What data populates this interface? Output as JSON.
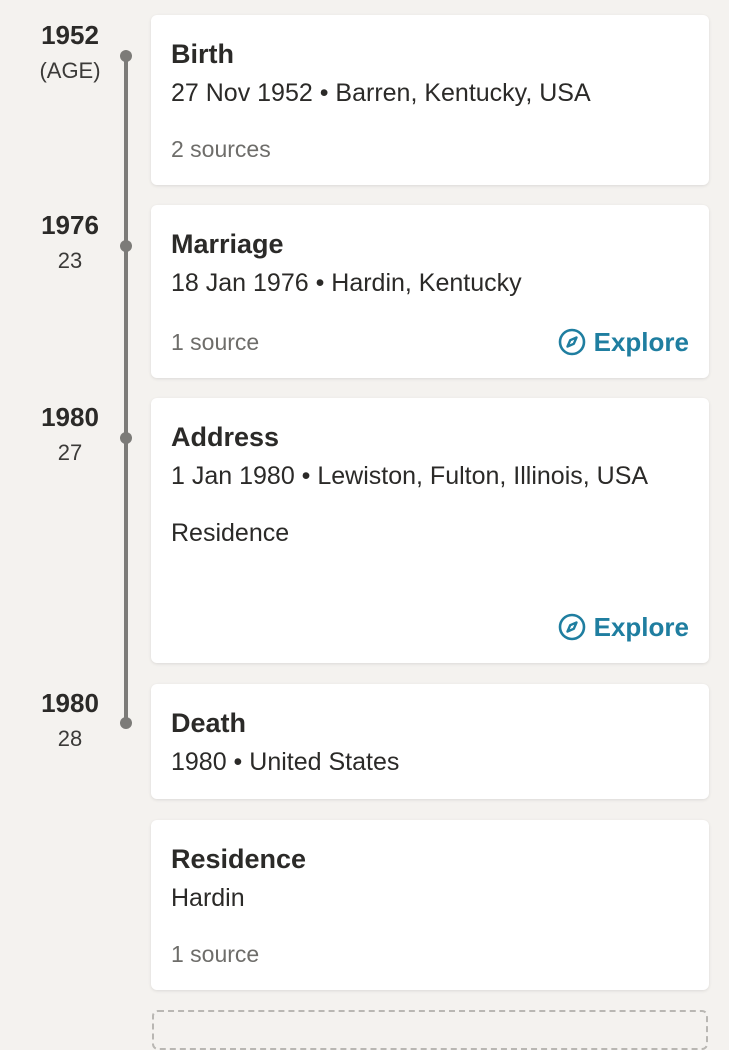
{
  "timeline": [
    {
      "year": "1952",
      "age": "(AGE)",
      "title": "Birth",
      "detail": "27 Nov 1952 • Barren, Kentucky, USA",
      "note": "",
      "sources": "2 sources",
      "explore": ""
    },
    {
      "year": "1976",
      "age": "23",
      "title": "Marriage",
      "detail": "18 Jan 1976 • Hardin, Kentucky",
      "note": "",
      "sources": "1 source",
      "explore": "Explore"
    },
    {
      "year": "1980",
      "age": "27",
      "title": "Address",
      "detail": "1 Jan 1980 • Lewiston, Fulton, Illinois, USA",
      "note": "Residence",
      "sources": "",
      "explore": "Explore"
    },
    {
      "year": "1980",
      "age": "28",
      "title": "Death",
      "detail": "1980 • United States",
      "note": "",
      "sources": "",
      "explore": ""
    }
  ],
  "residence": {
    "title": "Residence",
    "detail": "Hardin",
    "sources": "1 source"
  },
  "colors": {
    "background": "#f4f2ef",
    "card": "#ffffff",
    "accent": "#1f7ea0",
    "timeline": "#7c7b78",
    "muted_text": "#6e6d6a"
  },
  "icons": {
    "explore": "compass-icon"
  }
}
